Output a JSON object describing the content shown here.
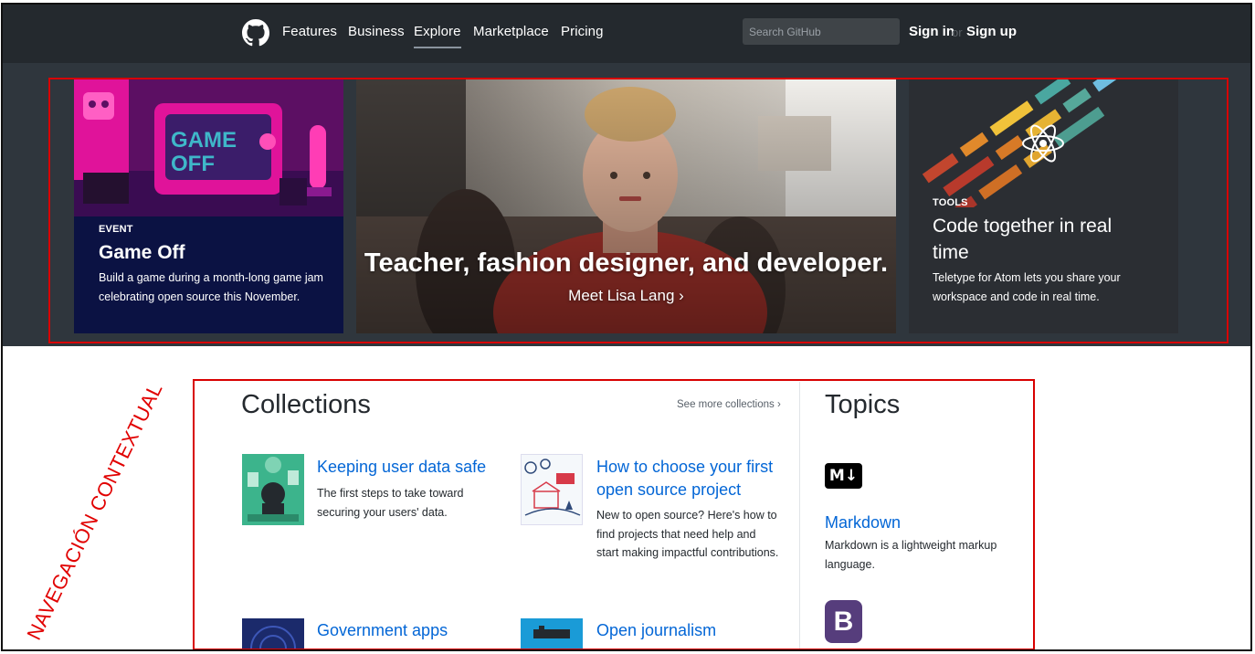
{
  "header": {
    "logo_icon": "github-octocat-icon",
    "nav": [
      "Features",
      "Business",
      "Explore",
      "Marketplace",
      "Pricing"
    ],
    "active_nav": "Explore",
    "search_placeholder": "Search GitHub",
    "sign_in": "Sign in",
    "or": "or",
    "sign_up": "Sign up"
  },
  "hero": {
    "left": {
      "eyebrow": "EVENT",
      "title": "Game Off",
      "description": "Build a game during a month-long game jam celebrating open source this November.",
      "art_text": "GAME OFF"
    },
    "center": {
      "title": "Teacher, fashion designer, and developer.",
      "link": "Meet Lisa Lang ›"
    },
    "right": {
      "eyebrow": "TOOLS",
      "title": "Code together in real time",
      "description": "Teletype for Atom lets you share your workspace and code in real time.",
      "icon": "atom-icon"
    }
  },
  "annotation": "NAVEGACIÓN CONTEXTUAL",
  "collections": {
    "heading": "Collections",
    "see_more": "See more collections ›",
    "items": [
      {
        "title": "Keeping user data safe",
        "description": "The first steps to take toward securing your users' data."
      },
      {
        "title": "How to choose your first open source project",
        "description": "New to open source? Here's how to find projects that need help and start making impactful contributions."
      },
      {
        "title": "Government apps",
        "description": ""
      },
      {
        "title": "Open journalism",
        "description": ""
      }
    ]
  },
  "topics": {
    "heading": "Topics",
    "items": [
      {
        "title": "Markdown",
        "description": "Markdown is a lightweight markup language.",
        "logo_text": "M↓"
      },
      {
        "title": "",
        "description": "",
        "logo_text": "B"
      }
    ]
  },
  "colors": {
    "header_bg": "#24292e",
    "hero_band_bg": "#2f363d",
    "link_blue": "#0366d6",
    "annotation_red": "#e10000"
  }
}
